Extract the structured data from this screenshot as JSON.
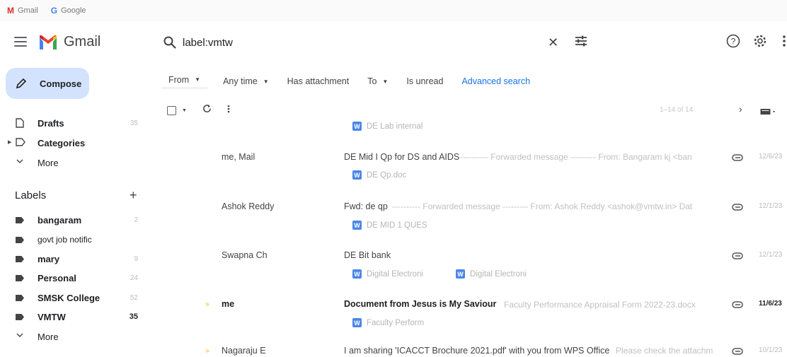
{
  "bookmarks": [
    {
      "label": "Gmail",
      "icon": "gmail-icon"
    },
    {
      "label": "Google",
      "icon": "google-icon"
    }
  ],
  "header": {
    "app_name": "Gmail",
    "search_value": "label:vmtw"
  },
  "sidebar": {
    "compose_label": "Compose",
    "nav": [
      {
        "label": "Drafts",
        "count": "35"
      },
      {
        "label": "Categories"
      },
      {
        "label": "More"
      }
    ],
    "labels_title": "Labels",
    "labels": [
      {
        "label": "bangaram",
        "count": "2"
      },
      {
        "label": "govt job notific",
        "count": ""
      },
      {
        "label": "mary",
        "count": "9"
      },
      {
        "label": "Personal",
        "count": "24"
      },
      {
        "label": "SMSK College",
        "count": "52"
      },
      {
        "label": "VMTW",
        "count": "35"
      }
    ],
    "labels_more": "More"
  },
  "filters": [
    {
      "label": "From",
      "dropdown": true
    },
    {
      "label": "Any time",
      "dropdown": true
    },
    {
      "label": "Has attachment",
      "dropdown": false
    },
    {
      "label": "To",
      "dropdown": true
    },
    {
      "label": "Is unread",
      "dropdown": false
    }
  ],
  "advanced_search": "Advanced search",
  "pagination": "1–14 of 14",
  "emails": [
    {
      "attachments": [
        "DE Lab internal"
      ]
    },
    {
      "sender": "me, Mail",
      "subject": "DE Mid I Qp for DS and AIDS",
      "snippet": "---------- Forwarded message --------- From: Bangaram kj <ban",
      "date": "12/6/23",
      "attachments": [
        "DE Qp.doc"
      ]
    },
    {
      "sender": "Ashok Reddy",
      "subject": "Fwd: de qp",
      "snippet": "---------- Forwarded message --------- From: Ashok Reddy <ashok@vmtw.in> Dat",
      "date": "12/1/23",
      "attachments": [
        "DE MID 1 QUES"
      ]
    },
    {
      "sender": "Swapna Ch",
      "subject": "DE Bit bank",
      "snippet": "",
      "date": "12/1/23",
      "attachments": [
        "Digital Electroni",
        "Digital Electroni"
      ]
    },
    {
      "sender": "me",
      "subject": "Document from Jesus is My Saviour",
      "snippet": "Faculty Performance Appraisal Form 2022-23.docx",
      "date": "11/6/23",
      "attachments": [
        "Faculty Perform"
      ]
    },
    {
      "sender": "Nagaraju E",
      "subject": "I am sharing 'ICACCT Brochure 2021.pdf' with you from WPS Office",
      "snippet": "Please check the attachm",
      "date": "10/1/23"
    }
  ],
  "colors": {
    "compose_bg": "#d3e3fd",
    "accent_blue": "#1a73e8",
    "important_marker": "#f4b400",
    "word_icon": "#4a86e8"
  }
}
